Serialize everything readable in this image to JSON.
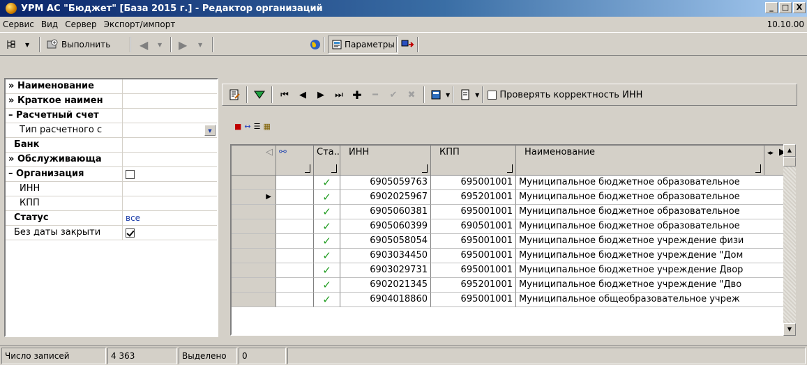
{
  "window": {
    "title": "УРМ АС \"Бюджет\" [База 2015 г.] - Редактор организаций",
    "minimize": "_",
    "maximize": "□",
    "close": "X"
  },
  "menu": {
    "items": [
      "Сервис",
      "Вид",
      "Сервер",
      "Экспорт/импорт"
    ],
    "version": "10.10.00"
  },
  "toolbar": {
    "execute_label": "Выполнить",
    "params_label": "Параметры"
  },
  "left_panel": {
    "rows": [
      {
        "label": "Наименование",
        "bold": true,
        "prefix": "»",
        "value": ""
      },
      {
        "label": "Краткое наимен",
        "bold": true,
        "prefix": "»",
        "value": ""
      },
      {
        "label": "Расчетный счет",
        "bold": true,
        "prefix": "–",
        "value": ""
      },
      {
        "label": "Тип расчетного с",
        "bold": false,
        "prefix": "",
        "value": ""
      },
      {
        "label": "Банк",
        "bold": true,
        "prefix": "",
        "value": ""
      },
      {
        "label": "Обслуживающа",
        "bold": true,
        "prefix": "»",
        "value": ""
      },
      {
        "label": "Организация",
        "bold": true,
        "prefix": "–",
        "value": ""
      },
      {
        "label": "ИНН",
        "bold": false,
        "prefix": "",
        "value": ""
      },
      {
        "label": "КПП",
        "bold": false,
        "prefix": "",
        "value": ""
      },
      {
        "label": "Статус",
        "bold": true,
        "prefix": "",
        "value": "все"
      },
      {
        "label": "Без даты закрыти",
        "bold": false,
        "prefix": "",
        "value": ""
      }
    ]
  },
  "right_toolbar": {
    "check_inn_label": "Проверять корректность ИНН"
  },
  "grid": {
    "columns": [
      "Ста..",
      "ИНН",
      "КПП",
      "Наименование"
    ],
    "rows": [
      {
        "inn": "6905059763",
        "kpp": "695001001",
        "name": "Муниципальное бюджетное образовательное"
      },
      {
        "inn": "6902025967",
        "kpp": "695201001",
        "name": "Муниципальное бюджетное образовательное"
      },
      {
        "inn": "6905060381",
        "kpp": "695001001",
        "name": "Муниципальное бюджетное образовательное"
      },
      {
        "inn": "6905060399",
        "kpp": "690501001",
        "name": "Муниципальное бюджетное образовательное"
      },
      {
        "inn": "6905058054",
        "kpp": "695001001",
        "name": "Муниципальное бюджетное учреждение физи"
      },
      {
        "inn": "6903034450",
        "kpp": "695001001",
        "name": "Муниципальное бюджетное учреждение \"Дом"
      },
      {
        "inn": "6903029731",
        "kpp": "695001001",
        "name": "Муниципальное бюджетное учреждение Двор"
      },
      {
        "inn": "6902021345",
        "kpp": "695201001",
        "name": "Муниципальное бюджетное учреждение \"Дво"
      },
      {
        "inn": "6904018860",
        "kpp": "695001001",
        "name": "Муниципальное общеобразовательное учреж"
      }
    ]
  },
  "status": {
    "records_label": "Число записей",
    "records_value": "4 363",
    "selected_label": "Выделено",
    "selected_value": "0"
  },
  "colors": {
    "title_gradient_start": "#0a246a",
    "title_gradient_end": "#a6caf0",
    "check_green": "#1f9c1f",
    "status_value": "#1a3ba8"
  }
}
